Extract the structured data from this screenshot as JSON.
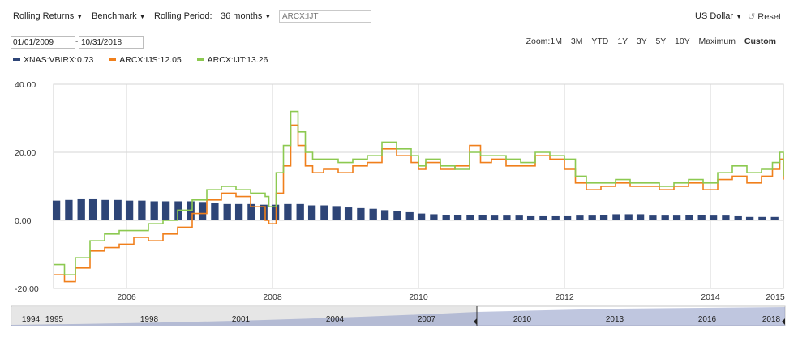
{
  "toolbar": {
    "rolling_returns": "Rolling Returns",
    "benchmark": "Benchmark",
    "rolling_period_label": "Rolling Period:",
    "rolling_period_value": "36 months",
    "ticker_placeholder": "ARCX:IJT",
    "currency": "US Dollar",
    "reset": "Reset"
  },
  "dates": {
    "start": "01/01/2009",
    "end": "10/31/2018"
  },
  "zoom": {
    "label": "Zoom:",
    "options": [
      "1M",
      "3M",
      "YTD",
      "1Y",
      "3Y",
      "5Y",
      "10Y",
      "Maximum",
      "Custom"
    ],
    "active": "Custom"
  },
  "colors": {
    "vbirx": "#2e4577",
    "ijs": "#f07f1b",
    "ijt": "#8cc950",
    "navigator": "#8b97c4"
  },
  "navigator": {
    "labels": [
      "1994",
      "1995",
      "1998",
      "2001",
      "2004",
      "2007",
      "2010",
      "2013",
      "2016",
      "2018"
    ]
  },
  "chart_data": {
    "type": "bar",
    "title": "",
    "xlabel": "",
    "ylabel": "",
    "ylim": [
      -20,
      40
    ],
    "y_ticks": [
      "40.00",
      "20.00",
      "0.00",
      "-20.00"
    ],
    "x_ticks": [
      "2006",
      "2008",
      "2010",
      "2012",
      "2014",
      "2015"
    ],
    "x_range": [
      2005.0,
      2015.0
    ],
    "legend_position": "top-left",
    "grid": true,
    "series": [
      {
        "name": "XNAS:VBIRX:0.73",
        "type": "bar",
        "color": "#2e4577",
        "x": [
          2005.04,
          2005.21,
          2005.38,
          2005.54,
          2005.71,
          2005.88,
          2006.04,
          2006.21,
          2006.38,
          2006.54,
          2006.71,
          2006.88,
          2007.04,
          2007.21,
          2007.38,
          2007.54,
          2007.71,
          2007.88,
          2008.04,
          2008.21,
          2008.38,
          2008.54,
          2008.71,
          2008.88,
          2009.04,
          2009.21,
          2009.38,
          2009.54,
          2009.71,
          2009.88,
          2010.04,
          2010.21,
          2010.38,
          2010.54,
          2010.71,
          2010.88,
          2011.04,
          2011.21,
          2011.38,
          2011.54,
          2011.71,
          2011.88,
          2012.04,
          2012.21,
          2012.38,
          2012.54,
          2012.71,
          2012.88,
          2013.04,
          2013.21,
          2013.38,
          2013.54,
          2013.71,
          2013.88,
          2014.04,
          2014.21,
          2014.38,
          2014.54,
          2014.71,
          2014.88
        ],
        "values": [
          5.8,
          6.0,
          6.2,
          6.2,
          6.0,
          6.0,
          5.8,
          5.8,
          5.6,
          5.6,
          5.6,
          5.6,
          5.4,
          5.0,
          4.8,
          4.8,
          4.8,
          4.6,
          4.6,
          4.8,
          4.8,
          4.4,
          4.4,
          4.2,
          3.8,
          3.6,
          3.4,
          3.0,
          2.8,
          2.4,
          2.0,
          1.8,
          1.6,
          1.6,
          1.6,
          1.6,
          1.4,
          1.4,
          1.4,
          1.2,
          1.2,
          1.2,
          1.2,
          1.4,
          1.4,
          1.6,
          1.8,
          1.8,
          1.8,
          1.4,
          1.4,
          1.4,
          1.6,
          1.6,
          1.4,
          1.4,
          1.2,
          1.0,
          1.0,
          1.0
        ]
      },
      {
        "name": "ARCX:IJS:12.05",
        "type": "line",
        "color": "#f07f1b",
        "x": [
          2005.0,
          2005.15,
          2005.3,
          2005.5,
          2005.7,
          2005.9,
          2006.1,
          2006.3,
          2006.5,
          2006.7,
          2006.9,
          2007.1,
          2007.3,
          2007.5,
          2007.7,
          2007.9,
          2007.95,
          2008.05,
          2008.15,
          2008.25,
          2008.35,
          2008.45,
          2008.55,
          2008.7,
          2008.9,
          2009.1,
          2009.3,
          2009.5,
          2009.7,
          2009.9,
          2010.0,
          2010.1,
          2010.3,
          2010.5,
          2010.7,
          2010.85,
          2011.0,
          2011.2,
          2011.4,
          2011.6,
          2011.8,
          2012.0,
          2012.15,
          2012.3,
          2012.5,
          2012.7,
          2012.9,
          2013.1,
          2013.3,
          2013.5,
          2013.7,
          2013.9,
          2014.1,
          2014.3,
          2014.5,
          2014.7,
          2014.85,
          2014.95,
          2015.0
        ],
        "values": [
          -16,
          -18,
          -14,
          -9,
          -8,
          -7,
          -5,
          -6,
          -4,
          -2,
          2,
          6,
          8,
          7,
          4,
          0,
          -1,
          8,
          16,
          28,
          22,
          16,
          14,
          15,
          14,
          16,
          17,
          21,
          19,
          17,
          15,
          17,
          15,
          16,
          22,
          17,
          18,
          16,
          16,
          19,
          18,
          15,
          11,
          9,
          10,
          11,
          10,
          10,
          9,
          10,
          11,
          9,
          12,
          13,
          11,
          13,
          15,
          18,
          12
        ]
      },
      {
        "name": "ARCX:IJT:13.26",
        "type": "line",
        "color": "#8cc950",
        "x": [
          2005.0,
          2005.15,
          2005.3,
          2005.5,
          2005.7,
          2005.9,
          2006.1,
          2006.3,
          2006.5,
          2006.7,
          2006.9,
          2007.1,
          2007.3,
          2007.5,
          2007.7,
          2007.9,
          2007.95,
          2008.05,
          2008.15,
          2008.25,
          2008.35,
          2008.45,
          2008.55,
          2008.7,
          2008.9,
          2009.1,
          2009.3,
          2009.5,
          2009.7,
          2009.9,
          2010.0,
          2010.1,
          2010.3,
          2010.5,
          2010.7,
          2010.85,
          2011.0,
          2011.2,
          2011.4,
          2011.6,
          2011.8,
          2012.0,
          2012.15,
          2012.3,
          2012.5,
          2012.7,
          2012.9,
          2013.1,
          2013.3,
          2013.5,
          2013.7,
          2013.9,
          2014.1,
          2014.3,
          2014.5,
          2014.7,
          2014.85,
          2014.95,
          2015.0
        ],
        "values": [
          -13,
          -16,
          -11,
          -6,
          -4,
          -3,
          -3,
          -1,
          0,
          3,
          6,
          9,
          10,
          9,
          8,
          7,
          4,
          14,
          22,
          32,
          26,
          20,
          18,
          18,
          17,
          18,
          19,
          23,
          21,
          19,
          16,
          18,
          16,
          15,
          20,
          19,
          19,
          18,
          17,
          20,
          19,
          18,
          13,
          11,
          11,
          12,
          11,
          11,
          10,
          11,
          12,
          11,
          14,
          16,
          14,
          15,
          17,
          20,
          13
        ]
      }
    ]
  }
}
